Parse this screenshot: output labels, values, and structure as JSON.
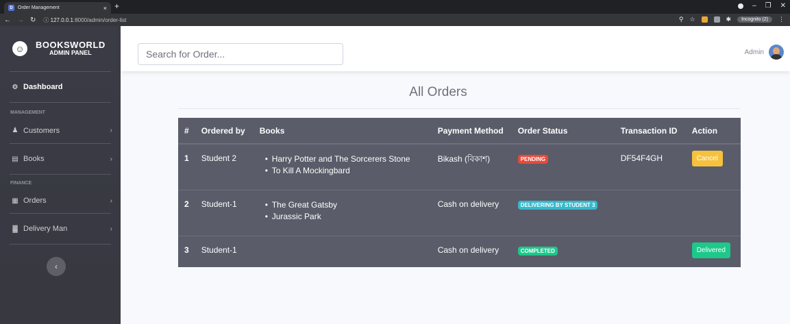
{
  "browser": {
    "tab_title": "Order Management",
    "favicon": "D",
    "tab_close": "×",
    "new_tab": "+",
    "url_host": "127.0.0.1",
    "url_rest": ":8000/admin/order-list",
    "incognito_label": "Incognito (2)"
  },
  "sidebar": {
    "brand_line1": "BOOKSWORLD",
    "brand_line2": "ADMIN PANEL",
    "dashboard": "Dashboard",
    "heading_management": "MANAGEMENT",
    "customers": "Customers",
    "books": "Books",
    "heading_finance": "FINANCE",
    "orders": "Orders",
    "delivery_man": "Delivery Man"
  },
  "topbar": {
    "search_placeholder": "Search for Order...",
    "user_name": "Admin"
  },
  "main": {
    "title": "All Orders",
    "columns": [
      "#",
      "Ordered by",
      "Books",
      "Payment Method",
      "Order Status",
      "Transaction ID",
      "Action"
    ],
    "orders": [
      {
        "num": "1",
        "ordered_by": "Student 2",
        "books": [
          "Harry Potter and The Sorcerers Stone",
          "To Kill A Mockingbard"
        ],
        "payment": "Bikash (বিকাশ)",
        "status": "PENDING",
        "transaction_id": "DF54F4GH",
        "action": "Cancel"
      },
      {
        "num": "2",
        "ordered_by": "Student-1",
        "books": [
          "The Great Gatsby",
          "Jurassic Park"
        ],
        "payment": "Cash on delivery",
        "status": "DELIVERING BY STUDENT 3",
        "transaction_id": "",
        "action": ""
      },
      {
        "num": "3",
        "ordered_by": "Student-1",
        "books": [],
        "payment": "Cash on delivery",
        "status": "COMPLETED",
        "transaction_id": "",
        "action": "Delivered"
      }
    ]
  },
  "colors": {
    "sidebar": "#3a3b45",
    "table_bg": "#5a5c69",
    "pending": "#e74a3b",
    "delivering": "#36b9cc",
    "completed": "#1cc88a",
    "cancel": "#f6c23e"
  }
}
